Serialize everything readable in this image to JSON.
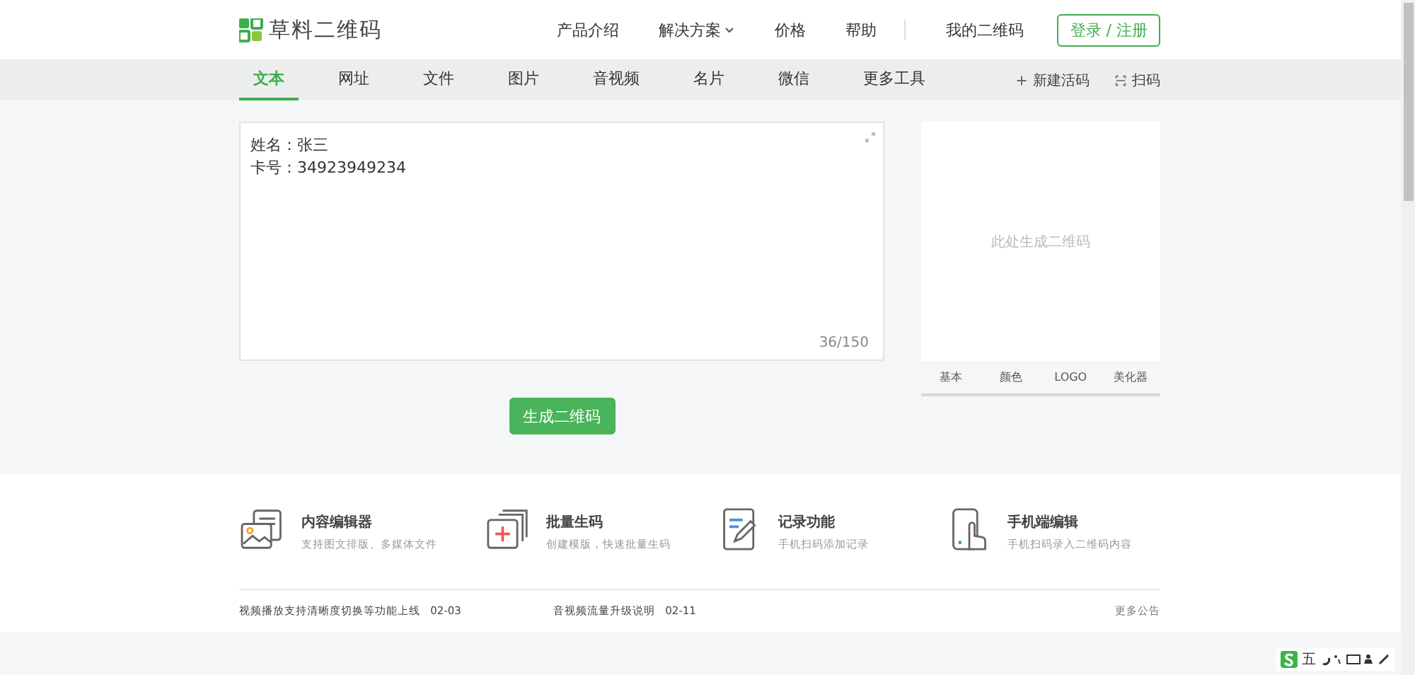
{
  "header": {
    "logo_text": "草料二维码",
    "nav": [
      {
        "label": "产品介绍",
        "dropdown": false
      },
      {
        "label": "解决方案",
        "dropdown": true
      },
      {
        "label": "价格",
        "dropdown": false
      },
      {
        "label": "帮助",
        "dropdown": false
      }
    ],
    "my_codes": "我的二维码",
    "login": "登录 / 注册"
  },
  "tabs": [
    {
      "label": "文本",
      "selected": true
    },
    {
      "label": "网址",
      "selected": false
    },
    {
      "label": "文件",
      "selected": false
    },
    {
      "label": "图片",
      "selected": false
    },
    {
      "label": "音视频",
      "selected": false
    },
    {
      "label": "名片",
      "selected": false
    },
    {
      "label": "微信",
      "selected": false
    },
    {
      "label": "更多工具",
      "selected": false
    }
  ],
  "tab_actions": [
    {
      "kind": "new",
      "label": "新建活码"
    },
    {
      "kind": "scan",
      "label": "扫码"
    }
  ],
  "editor": {
    "lines": [
      "姓名：张三",
      "卡号：34923949234"
    ],
    "counter": "36/150"
  },
  "qr_panel": {
    "placeholder": "此处生成二维码",
    "tabs": [
      {
        "label": "基本",
        "selected": false
      },
      {
        "label": "颜色",
        "selected": false
      },
      {
        "label": "LOGO",
        "selected": false
      },
      {
        "label": "美化器",
        "selected": false
      }
    ]
  },
  "generate_button": "生成二维码",
  "features": [
    {
      "kind": "editor",
      "title": "内容编辑器",
      "subtitle": "支持图文排版、多媒体文件"
    },
    {
      "kind": "batch",
      "title": "批量生码",
      "subtitle": "创建模版，快速批量生码"
    },
    {
      "kind": "record",
      "title": "记录功能",
      "subtitle": "手机扫码添加记录"
    },
    {
      "kind": "mobile",
      "title": "手机端编辑",
      "subtitle": "手机扫码录入二维码内容"
    }
  ],
  "notices": [
    {
      "text": "视频播放支持清晰度切换等功能上线",
      "date": "02-03"
    },
    {
      "text": "音视频流量升级说明",
      "date": "02-11"
    }
  ],
  "more_notices": "更多公告",
  "ime_toolbar": {
    "mode": "五"
  }
}
